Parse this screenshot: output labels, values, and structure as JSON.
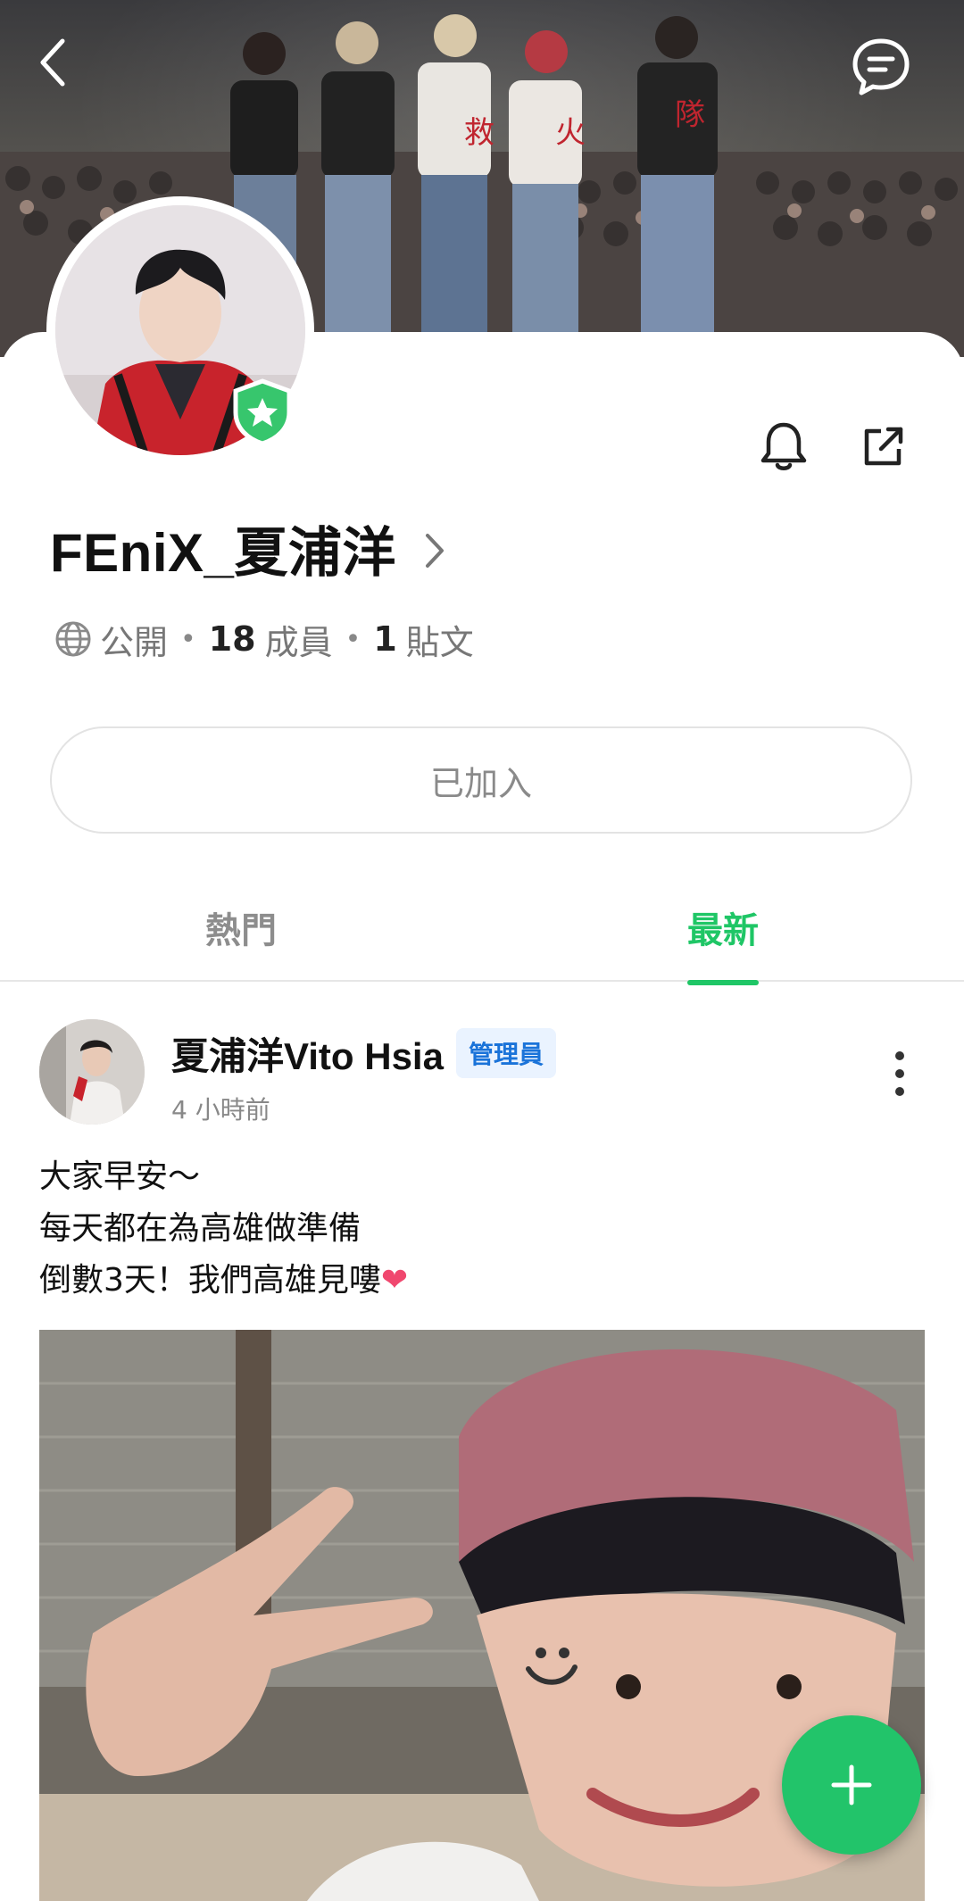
{
  "header": {
    "back_icon": "chevron-left-icon",
    "chat_icon": "chat-bubble-icon"
  },
  "group": {
    "name": "FEniX_夏浦洋",
    "privacy": "公開",
    "members_count": "18",
    "members_label": "成員",
    "posts_count": "1",
    "posts_label": "貼文",
    "joined_label": "已加入",
    "verified_icon": "star-shield-icon"
  },
  "actions": {
    "bell_icon": "bell-icon",
    "share_icon": "external-share-icon"
  },
  "tabs": [
    {
      "label": "熱門",
      "active": false
    },
    {
      "label": "最新",
      "active": true
    }
  ],
  "post": {
    "author": "夏浦洋Vito Hsia",
    "badge": "管理員",
    "time": "4 小時前",
    "lines": [
      "大家早安～",
      "每天都在為高雄做準備",
      "倒數3天！我們高雄見嘍"
    ],
    "heart_icon": "❤"
  },
  "colors": {
    "accent": "#1fc666",
    "fab": "#22c46a",
    "admin_badge_text": "#1a73d9",
    "admin_badge_bg": "#eaf3ff"
  }
}
